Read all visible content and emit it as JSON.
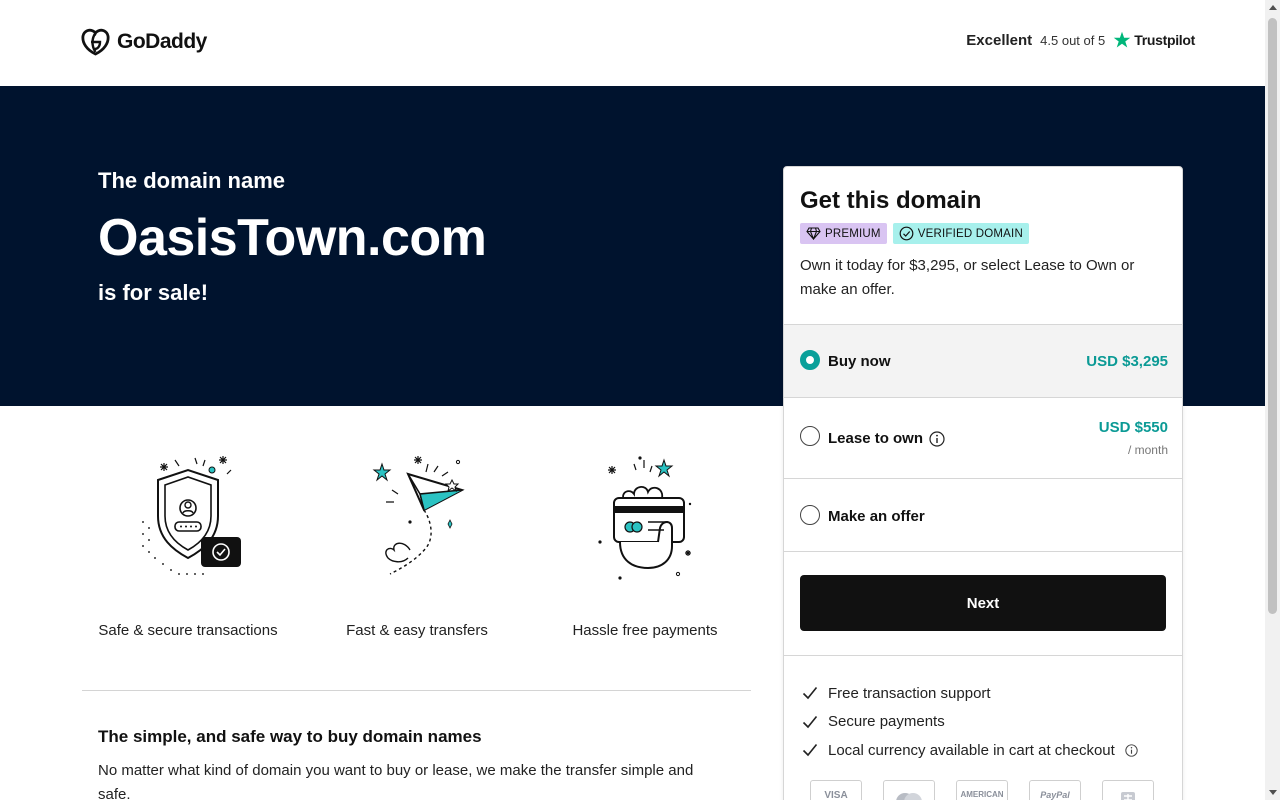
{
  "header": {
    "logo_text": "GoDaddy",
    "rating_label": "Excellent",
    "rating_score": "4.5 out of 5",
    "trustpilot": "Trustpilot"
  },
  "hero": {
    "pre": "The domain name",
    "domain": "OasisTown.com",
    "post": "is for sale!"
  },
  "features": [
    {
      "icon": "shield-lock-icon",
      "caption": "Safe & secure transactions"
    },
    {
      "icon": "paper-plane-icon",
      "caption": "Fast & easy transfers"
    },
    {
      "icon": "card-payment-icon",
      "caption": "Hassle free payments"
    }
  ],
  "info": {
    "title": "The simple, and safe way to buy domain names",
    "text": "No matter what kind of domain you want to buy or lease, we make the transfer simple and safe."
  },
  "card": {
    "title": "Get this domain",
    "badge_premium": "PREMIUM",
    "badge_verified": "VERIFIED DOMAIN",
    "description": "Own it today for $3,295, or select Lease to Own or make an offer.",
    "options": [
      {
        "label": "Buy now",
        "price": "USD $3,295",
        "sub": "",
        "selected": true
      },
      {
        "label": "Lease to own",
        "price": "USD $550",
        "sub": "/ month",
        "selected": false
      },
      {
        "label": "Make an offer",
        "price": "",
        "sub": "",
        "selected": false
      }
    ],
    "next_label": "Next",
    "benefits": [
      "Free transaction support",
      "Secure payments",
      "Local currency available in cart at checkout"
    ],
    "payments": [
      "VISA",
      "",
      "AMERICAN",
      "PayPal",
      ""
    ]
  },
  "colors": {
    "hero_bg": "#00132e",
    "accent": "#09a09a",
    "price": "#0b9a95",
    "premium_badge": "#d9c4f2",
    "verified_badge": "#a7f0ec"
  }
}
